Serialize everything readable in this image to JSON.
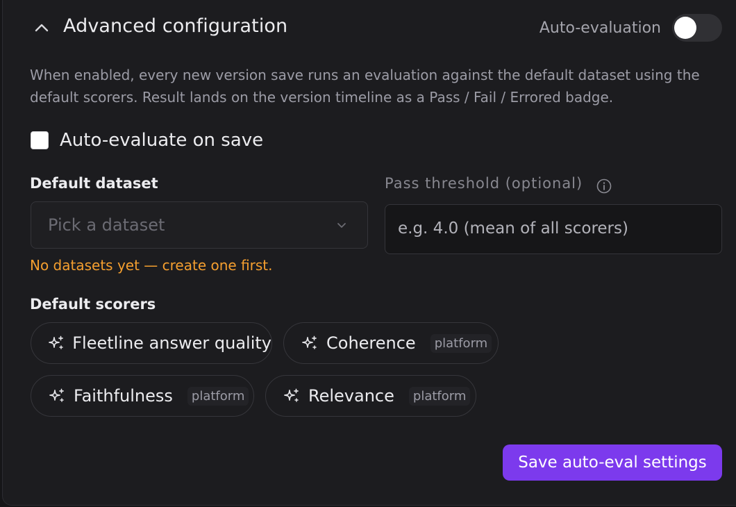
{
  "header": {
    "title": "Advanced configuration",
    "toggle_label": "Auto-evaluation",
    "toggle_on": false,
    "chevron_icon": "chevron-up-icon"
  },
  "description": "When enabled, every new version save runs an evaluation against the default dataset using the default scorers. Result lands on the version timeline as a Pass / Fail / Errored badge.",
  "auto_evaluate": {
    "label": "Auto-evaluate on save",
    "checked": false
  },
  "dataset": {
    "label": "Default dataset",
    "placeholder": "Pick a dataset",
    "warning": "No datasets yet — create one first."
  },
  "threshold": {
    "label": "Pass threshold (optional)",
    "placeholder": "e.g. 4.0 (mean of all scorers)",
    "info_icon": "info-icon"
  },
  "scorers": {
    "label": "Default scorers",
    "items": [
      {
        "name": "Fleetline answer quality",
        "tag": "",
        "icon": "sparkles-icon"
      },
      {
        "name": "Coherence",
        "tag": "platform",
        "icon": "sparkles-icon"
      },
      {
        "name": "Faithfulness",
        "tag": "platform",
        "icon": "sparkles-icon"
      },
      {
        "name": "Relevance",
        "tag": "platform",
        "icon": "sparkles-icon"
      }
    ]
  },
  "save_button": {
    "label": "Save auto-eval settings"
  },
  "colors": {
    "accent": "#7c3aed",
    "warning": "#f59f2f",
    "background": "#1c1c1f"
  }
}
